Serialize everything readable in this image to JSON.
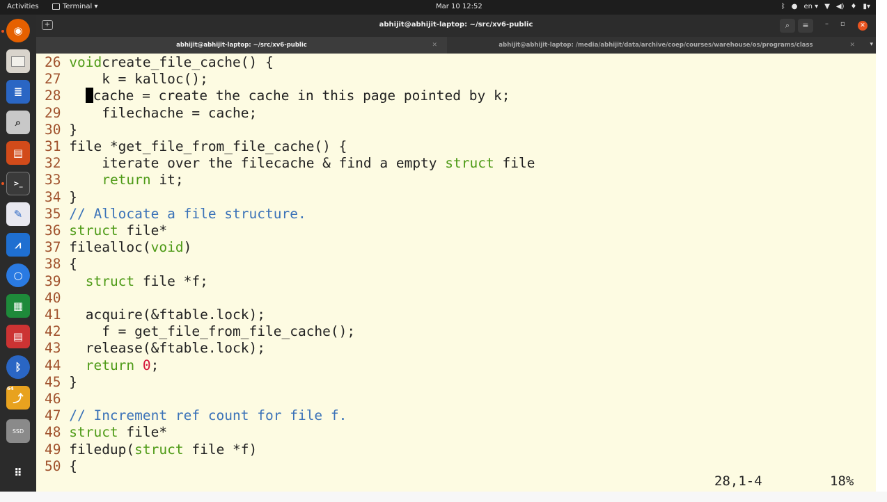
{
  "topbar": {
    "activities": "Activities",
    "app_menu": "Terminal ▾",
    "clock": "Mar 10  12:52",
    "language": "en ▾",
    "tray_icons": [
      "bluetooth-icon",
      "chat-icon",
      "wifi-icon",
      "volume-icon",
      "mic-icon",
      "battery-icon"
    ]
  },
  "dock": {
    "items": [
      "firefox-icon",
      "files-icon",
      "text-editor-icon",
      "screenshot-icon",
      "impress-icon",
      "terminal-icon",
      "notes-icon",
      "system-monitor-icon",
      "signal-icon",
      "calc-icon",
      "viewer-icon",
      "bluetooth-icon",
      "app64-icon",
      "ssd-icon",
      "app-grid-icon"
    ],
    "ssd_label": "SSD",
    "badge_64": "64"
  },
  "window": {
    "title": "abhijit@abhijit-laptop: ~/src/xv6-public",
    "tabs": [
      {
        "label": "abhijit@abhijit-laptop: ~/src/xv6-public",
        "active": true
      },
      {
        "label": "abhijit@abhijit-laptop: /media/abhijit/data/archive/coep/courses/warehouse/os/programs/class",
        "active": false
      }
    ]
  },
  "editor": {
    "lines": [
      {
        "n": "26",
        "parts": [
          [
            "kw",
            "void"
          ],
          [
            "",
            "create_file_cache() {"
          ]
        ]
      },
      {
        "n": "27",
        "parts": [
          [
            "",
            "    k = kalloc();"
          ]
        ]
      },
      {
        "n": "28",
        "parts": [
          [
            "",
            "  "
          ],
          [
            "cursor",
            ""
          ],
          [
            "",
            "cache = create the cache in this page pointed by k;"
          ]
        ]
      },
      {
        "n": "29",
        "parts": [
          [
            "",
            "    filechache = cache;"
          ]
        ]
      },
      {
        "n": "30",
        "parts": [
          [
            "",
            "}"
          ]
        ]
      },
      {
        "n": "31",
        "parts": [
          [
            "",
            "file *get_file_from_file_cache() {"
          ]
        ]
      },
      {
        "n": "32",
        "parts": [
          [
            "",
            "    iterate over the filecache & find a empty "
          ],
          [
            "kw",
            "struct"
          ],
          [
            "",
            " file"
          ]
        ]
      },
      {
        "n": "33",
        "parts": [
          [
            "",
            "    "
          ],
          [
            "kw",
            "return"
          ],
          [
            "",
            " it;"
          ]
        ]
      },
      {
        "n": "34",
        "parts": [
          [
            "",
            "}"
          ]
        ]
      },
      {
        "n": "35",
        "parts": [
          [
            "cm",
            "// Allocate a file structure."
          ]
        ]
      },
      {
        "n": "36",
        "parts": [
          [
            "kw",
            "struct"
          ],
          [
            "",
            " file*"
          ]
        ]
      },
      {
        "n": "37",
        "parts": [
          [
            "",
            "filealloc("
          ],
          [
            "kw",
            "void"
          ],
          [
            "",
            ")"
          ]
        ]
      },
      {
        "n": "38",
        "parts": [
          [
            "",
            "{"
          ]
        ]
      },
      {
        "n": "39",
        "parts": [
          [
            "",
            "  "
          ],
          [
            "kw",
            "struct"
          ],
          [
            "",
            " file *f;"
          ]
        ]
      },
      {
        "n": "40",
        "parts": []
      },
      {
        "n": "41",
        "parts": [
          [
            "",
            "  acquire(&ftable.lock);"
          ]
        ]
      },
      {
        "n": "42",
        "parts": [
          [
            "",
            "    f = get_file_from_file_cache();"
          ]
        ]
      },
      {
        "n": "43",
        "parts": [
          [
            "",
            "  release(&ftable.lock);"
          ]
        ]
      },
      {
        "n": "44",
        "parts": [
          [
            "",
            "  "
          ],
          [
            "kw",
            "return"
          ],
          [
            "",
            " "
          ],
          [
            "num",
            "0"
          ],
          [
            "",
            ";"
          ]
        ]
      },
      {
        "n": "45",
        "parts": [
          [
            "",
            "}"
          ]
        ]
      },
      {
        "n": "46",
        "parts": []
      },
      {
        "n": "47",
        "parts": [
          [
            "cm",
            "// Increment ref count for file f."
          ]
        ]
      },
      {
        "n": "48",
        "parts": [
          [
            "kw",
            "struct"
          ],
          [
            "",
            " file*"
          ]
        ]
      },
      {
        "n": "49",
        "parts": [
          [
            "",
            "filedup("
          ],
          [
            "kw",
            "struct"
          ],
          [
            "",
            " file *f)"
          ]
        ]
      },
      {
        "n": "50",
        "parts": [
          [
            "",
            "{"
          ]
        ]
      }
    ],
    "status_position": "28,1-4",
    "status_percent": "18%"
  },
  "colors": {
    "editor_bg": "#fdfbe2",
    "line_number": "#a0522d",
    "keyword": "#4d9a16",
    "comment": "#3a72b8",
    "number": "#d4143a",
    "accent": "#e95420"
  }
}
